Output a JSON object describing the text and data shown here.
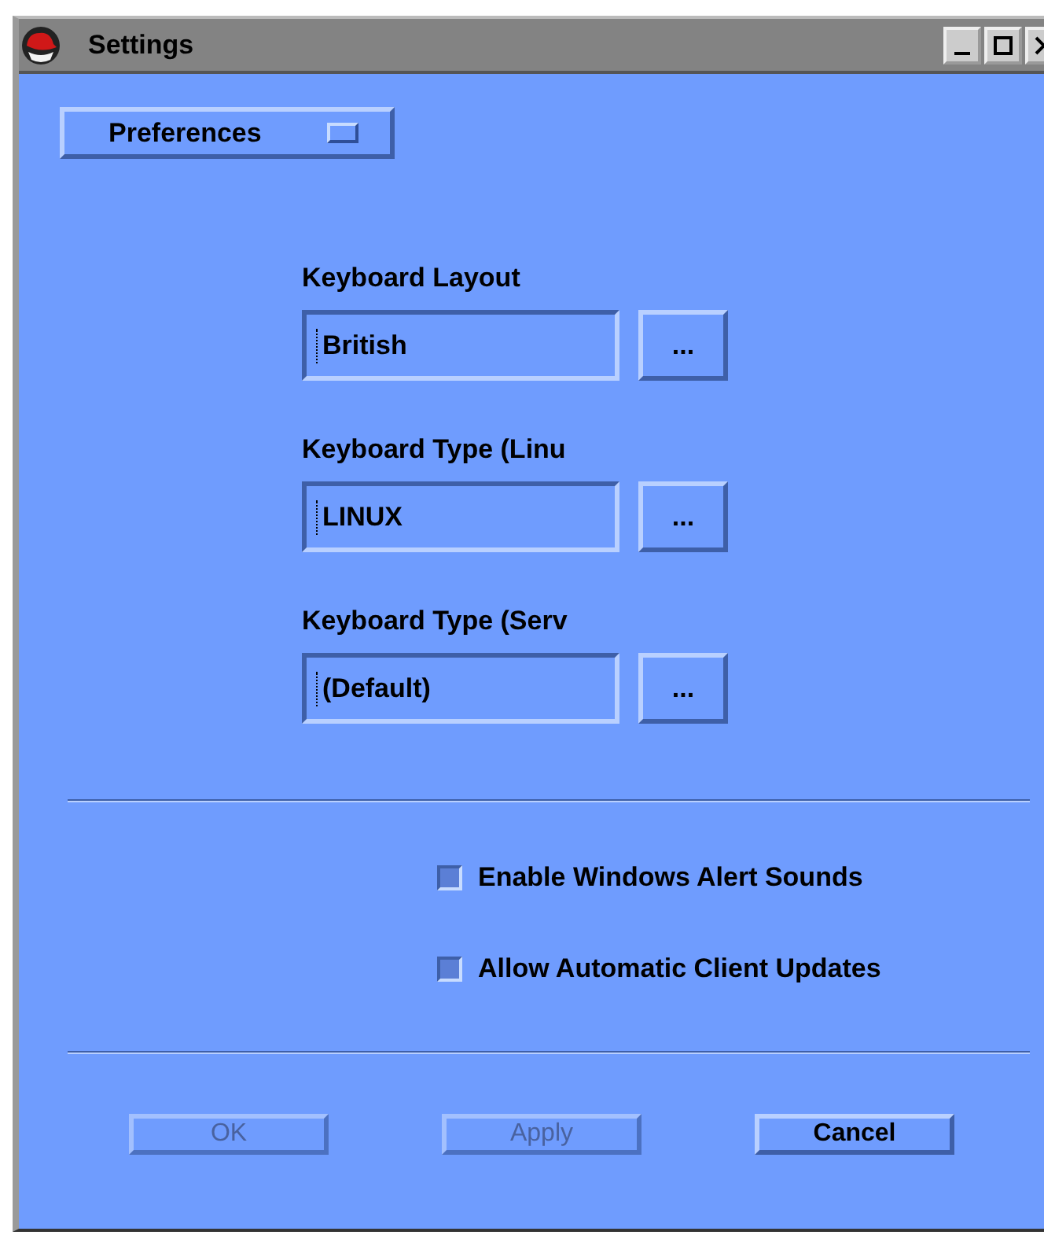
{
  "window": {
    "title": "Settings"
  },
  "menu_button": {
    "label": "Preferences"
  },
  "fields": [
    {
      "label": "Keyboard Layout",
      "value": "British",
      "browse": "..."
    },
    {
      "label": "Keyboard Type (Linu",
      "value": "LINUX",
      "browse": "..."
    },
    {
      "label": "Keyboard Type (Serv",
      "value": "(Default)",
      "browse": "..."
    }
  ],
  "options": [
    {
      "label": "Enable Windows Alert Sounds",
      "checked": false
    },
    {
      "label": "Allow Automatic Client Updates",
      "checked": false
    }
  ],
  "buttons": [
    {
      "label": "OK",
      "disabled": true
    },
    {
      "label": "Apply",
      "disabled": true
    },
    {
      "label": "Cancel",
      "disabled": false
    }
  ]
}
